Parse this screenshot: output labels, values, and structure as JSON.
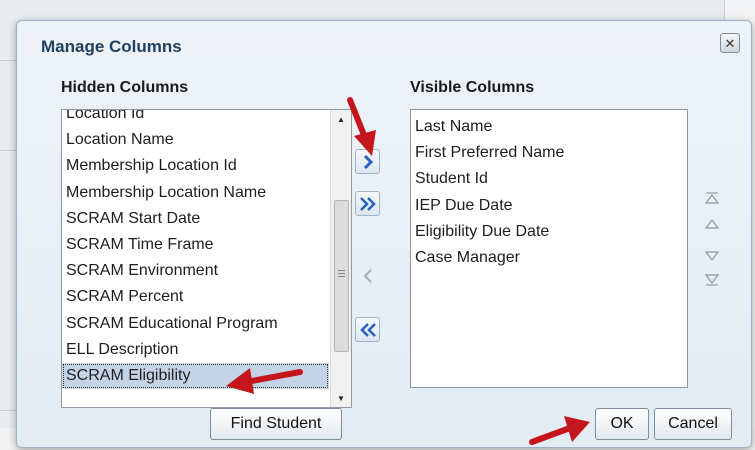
{
  "dialog": {
    "title": "Manage Columns",
    "close_glyph": "✕"
  },
  "hidden_columns": {
    "heading": "Hidden Columns",
    "items": [
      "Location Id",
      "Location Name",
      "Membership Location Id",
      "Membership Location Name",
      "SCRAM Start Date",
      "SCRAM Time Frame",
      "SCRAM Environment",
      "SCRAM Percent",
      "SCRAM Educational Program",
      "ELL Description",
      "SCRAM Eligibility"
    ],
    "selected": "SCRAM Eligibility"
  },
  "visible_columns": {
    "heading": "Visible Columns",
    "items": [
      "Last Name",
      "First Preferred Name",
      "Student Id",
      "IEP Due Date",
      "Eligibility Due Date",
      "Case Manager"
    ]
  },
  "shuttle": {
    "move": "move-right-icon",
    "move_all": "move-all-right-icon",
    "remove": "move-left-icon",
    "remove_all": "move-all-left-icon"
  },
  "buttons": {
    "find_student": "Find Student",
    "ok": "OK",
    "cancel": "Cancel"
  },
  "colors": {
    "accent_blue": "#2a63b8",
    "annotation_red": "#c4161c",
    "selection": "#c5d3e6"
  }
}
